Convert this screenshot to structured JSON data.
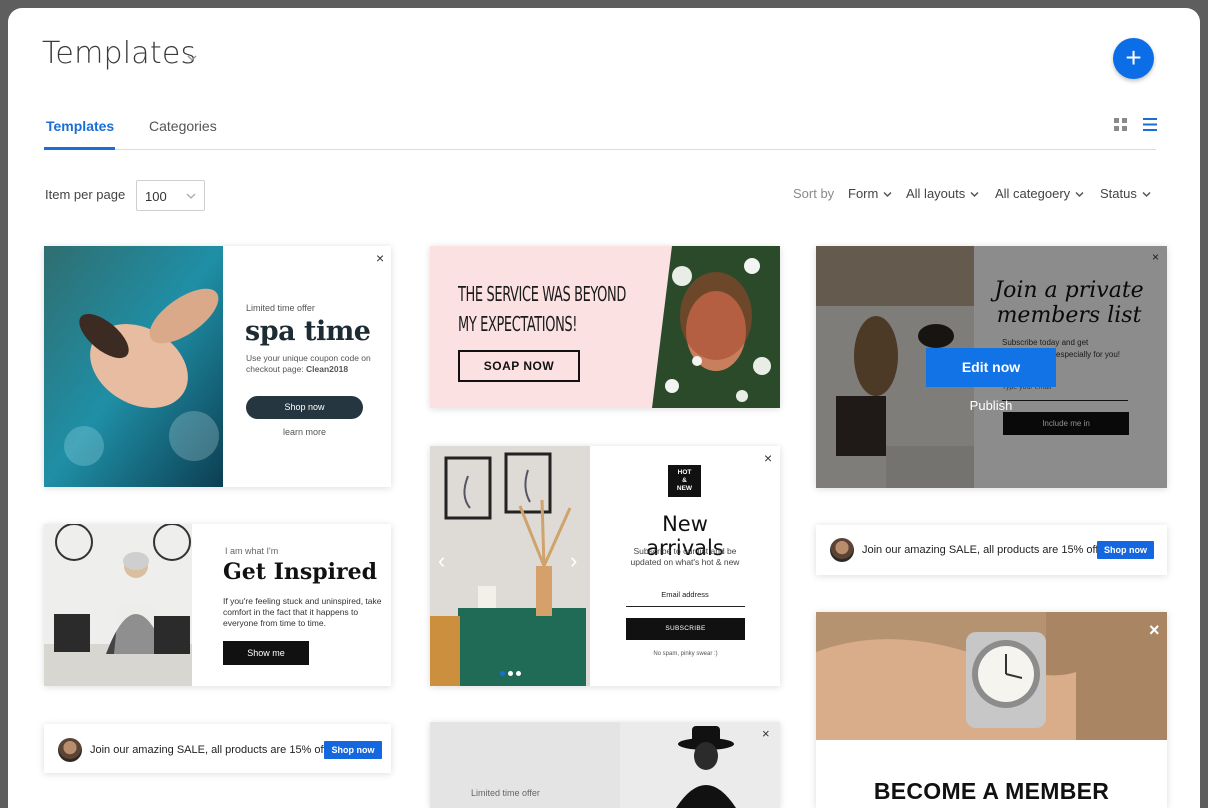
{
  "header": {
    "title": "Templates"
  },
  "tabs": [
    {
      "label": "Templates"
    },
    {
      "label": "Categories"
    }
  ],
  "toolbar": {
    "items_per_page_label": "Item per page",
    "items_per_page_value": "100",
    "sort_by_label": "Sort by",
    "filters": [
      "Form",
      "All layouts",
      "All categoery",
      "Status"
    ]
  },
  "cards": {
    "spa": {
      "eyebrow": "Limited time offer",
      "title": "spa time",
      "body": "Use your unique coupon code on checkout page:",
      "code": "Clean2018",
      "button": "Shop now",
      "link": "learn more"
    },
    "service": {
      "title_line1": "The service was beyond",
      "title_line2": "my expectations!",
      "button": "SOAP NOW"
    },
    "members": {
      "title_line1": "Join a private",
      "title_line2": "members list",
      "body": "Subscribe today and get",
      "body_suffix": "especially for you!",
      "field_hint": "Type your email",
      "button": "Include me in",
      "edit_button": "Edit now",
      "publish_link": "Publish"
    },
    "sale_bar": {
      "text": "Join our amazing SALE, all products are 15% off",
      "button": "Shop now"
    },
    "inspired": {
      "eyebrow": "I am what I'm",
      "title": "Get Inspired",
      "body": "If you're feeling stuck and uninspired, take comfort in the fact that it happens to everyone from time to time.",
      "button": "Show me"
    },
    "arrivals": {
      "badge": "HOT & NEW",
      "title": "New arrivals",
      "body": "Subscribe to our list and be updated on what's hot & new",
      "field": "Email address",
      "button": "SUBSCRIBE",
      "footnote": "No spam, pinky swear :)"
    },
    "limited": {
      "eyebrow": "Limited time offer"
    },
    "member": {
      "title": "BECOME A MEMBER"
    }
  },
  "icons": {
    "close": "×",
    "plus": "+",
    "carousel_prev": "‹",
    "carousel_next": "›"
  },
  "colors": {
    "accent": "#1a6fd6",
    "fab": "#0b6ee6",
    "cta_blue": "#1567e0"
  }
}
